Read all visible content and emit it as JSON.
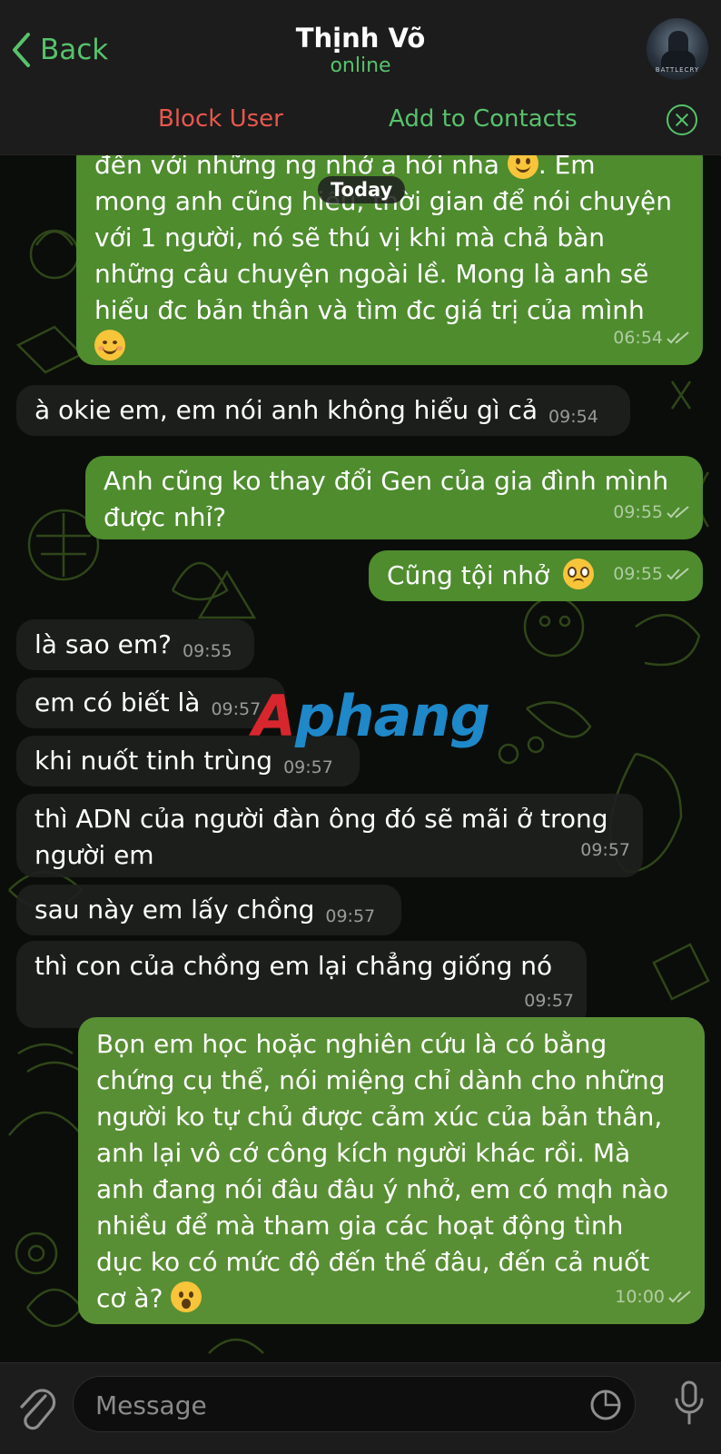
{
  "header": {
    "back_label": "Back",
    "title": "Thịnh Võ",
    "status": "online",
    "avatar_text": "BATTLECRY"
  },
  "actions": {
    "block_label": "Block User",
    "add_label": "Add to Contacts"
  },
  "date_pill": "Today",
  "watermark": {
    "part1": "A",
    "part2": "phang"
  },
  "messages": [
    {
      "direction": "out",
      "lines": [
        "đến với những ng nhớ a hỏi nha",
        "mong anh cũng hiểu, thời gian để nói chuyện",
        "với 1 người, nó sẽ thú vị khi mà chả bàn",
        "những câu chuyện ngoài lề. Mong là anh sẽ",
        "hiểu đc bản thân và tìm đc  giá trị của mình"
      ],
      "line1_suffix": ". Em",
      "time": "06:54"
    },
    {
      "direction": "in",
      "text": "à okie em, em nói anh không hiểu gì cả",
      "time": "09:54"
    },
    {
      "direction": "out",
      "lines": [
        "Anh cũng ko thay đổi Gen của gia đình mình",
        "được nhỉ?"
      ],
      "time": "09:55"
    },
    {
      "direction": "out",
      "text": "Cũng tội nhở",
      "time": "09:55"
    },
    {
      "direction": "in",
      "text": "là sao em?",
      "time": "09:55"
    },
    {
      "direction": "in",
      "text": "em có biết là",
      "time": "09:57"
    },
    {
      "direction": "in",
      "text": "khi nuốt tinh trùng",
      "time": "09:57"
    },
    {
      "direction": "in",
      "lines": [
        "thì ADN của người đàn ông đó sẽ mãi ở trong",
        "người em"
      ],
      "time": "09:57"
    },
    {
      "direction": "in",
      "text": "sau này em lấy chồng",
      "time": "09:57"
    },
    {
      "direction": "in",
      "lines": [
        "thì con của chồng em lại chẳng giống nó"
      ],
      "time": "09:57"
    },
    {
      "direction": "out",
      "lines": [
        "Bọn em học hoặc nghiên cứu là có bằng",
        "chứng cụ thể, nói miệng chỉ dành cho những",
        "người ko tự chủ được cảm xúc của bản thân,",
        "anh lại vô cớ công kích người khác rồi. Mà",
        "anh đang nói đâu đâu ý nhở, em có mqh nào",
        "nhiều để mà tham gia các hoạt động tình",
        "dục ko có mức độ đến thế đâu, đến cả nuốt",
        "cơ à?"
      ],
      "time": "10:00"
    }
  ],
  "input": {
    "placeholder": "Message"
  },
  "colors": {
    "accent": "#57c26b",
    "danger": "#e8574d",
    "outgoing_bubble": "#4e8c2e",
    "incoming_bubble": "#1e201e"
  }
}
